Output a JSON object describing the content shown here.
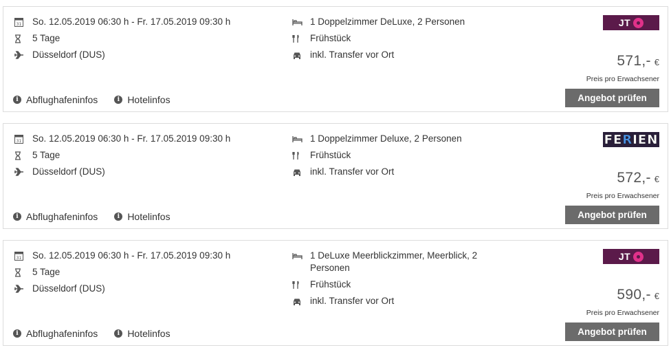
{
  "links": {
    "airport_info": "Abflughafeninfos",
    "hotel_info": "Hotelinfos"
  },
  "offers": [
    {
      "dates": "So. 12.05.2019 06:30 h - Fr. 17.05.2019 09:30 h",
      "duration": "5 Tage",
      "airport": "Düsseldorf (DUS)",
      "room": "1 Doppelzimmer DeLuxe, 2 Personen",
      "board": "Frühstück",
      "transfer": "inkl. Transfer vor Ort",
      "logo": "JT",
      "price": "571,-",
      "currency": "€",
      "price_note": "Preis pro Erwachsener",
      "button": "Angebot prüfen"
    },
    {
      "dates": "So. 12.05.2019 06:30 h - Fr. 17.05.2019 09:30 h",
      "duration": "5 Tage",
      "airport": "Düsseldorf (DUS)",
      "room": "1 Doppelzimmer Deluxe, 2 Personen",
      "board": "Frühstück",
      "transfer": "inkl. Transfer vor Ort",
      "logo_parts": [
        "FE",
        "R",
        "IEN"
      ],
      "price": "572,-",
      "currency": "€",
      "price_note": "Preis pro Erwachsener",
      "button": "Angebot prüfen"
    },
    {
      "dates": "So. 12.05.2019 06:30 h - Fr. 17.05.2019 09:30 h",
      "duration": "5 Tage",
      "airport": "Düsseldorf (DUS)",
      "room": "1 DeLuxe Meerblickzimmer, Meerblick, 2 Personen",
      "board": "Frühstück",
      "transfer": "inkl. Transfer vor Ort",
      "logo": "JT",
      "price": "590,-",
      "currency": "€",
      "price_note": "Preis pro Erwachsener",
      "button": "Angebot prüfen"
    }
  ],
  "colors": {
    "button_bg": "#6b6b6b",
    "jt_logo_bg": "#5b1a4a",
    "jt_flower": "#e0318a",
    "ferien_logo_bg": "#2a1f3a"
  },
  "icons": [
    "calendar-icon",
    "hourglass-icon",
    "plane-icon",
    "bed-icon",
    "cutlery-icon",
    "car-icon",
    "info-icon"
  ]
}
